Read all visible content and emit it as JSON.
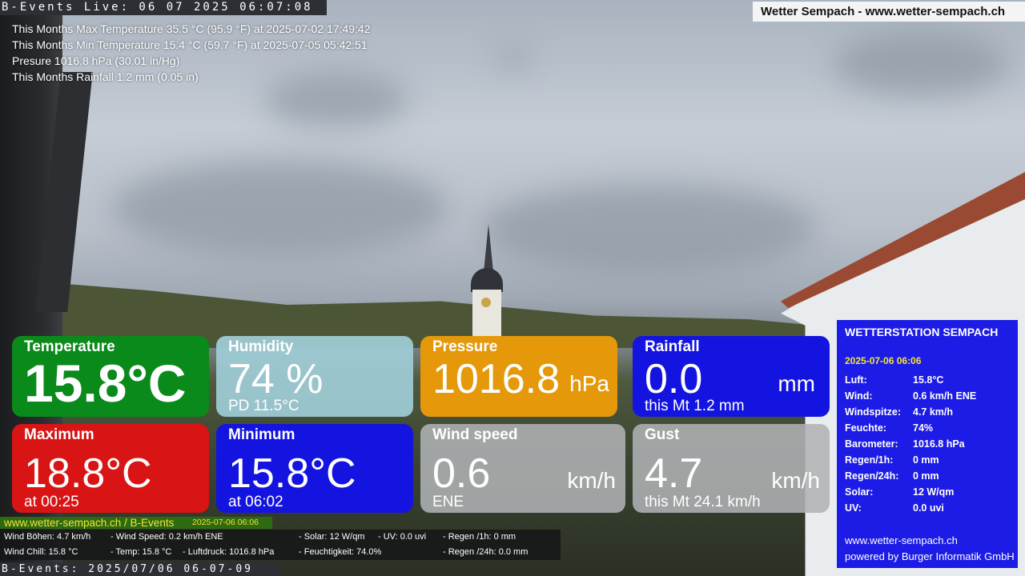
{
  "header": {
    "live_label": "B-Events Live: 06 07 2025 06:07:08",
    "site_title": "Wetter Sempach - www.wetter-sempach.ch"
  },
  "stats": [
    "This Months Max Temperature 35.5 °C (95.9 °F) at 2025-07-02 17:49:42",
    "This Months Min Temperature 15.4 °C (59.7 °F) at 2025-07-05 05:42:51",
    "Presure 1016.8 hPa (30.01 in/Hg)",
    "This Months Rainfall 1.2 mm (0.05 in)"
  ],
  "tiles": {
    "temperature": {
      "title": "Temperature",
      "value": "15.8°C",
      "color": "#0a8a1a"
    },
    "humidity": {
      "title": "Humidity",
      "value": "74 %",
      "sub": "PD 11.5°C"
    },
    "pressure": {
      "title": "Pressure",
      "value": "1016.8",
      "unit": "hPa",
      "color": "#e5990a"
    },
    "rainfall": {
      "title": "Rainfall",
      "value": "0.0",
      "unit": "mm",
      "sub": "this Mt 1.2 mm",
      "color": "#1414e0"
    },
    "maximum": {
      "title": "Maximum",
      "value": "18.8°C",
      "sub": "at 00:25",
      "color": "#d81414"
    },
    "minimum": {
      "title": "Minimum",
      "value": "15.8°C",
      "sub": "at 06:02",
      "color": "#1414e0"
    },
    "wind_speed": {
      "title": "Wind speed",
      "value": "0.6",
      "unit": "km/h",
      "sub": "ENE"
    },
    "gust": {
      "title": "Gust",
      "value": "4.7",
      "unit": "km/h",
      "sub": "this Mt 24.1 km/h"
    }
  },
  "station": {
    "title": "WETTERSTATION SEMPACH",
    "date": "2025-07-06 06:06",
    "rows": [
      {
        "key": "Luft:",
        "value": "15.8°C"
      },
      {
        "key": "Wind:",
        "value": "0.6 km/h  ENE"
      },
      {
        "key": "Windspitze:",
        "value": "4.7 km/h"
      },
      {
        "key": "Feuchte:",
        "value": "74%"
      },
      {
        "key": "Barometer:",
        "value": "1016.8 hPa"
      },
      {
        "key": "Regen/1h:",
        "value": "0 mm"
      },
      {
        "key": "Regen/24h:",
        "value": "0 mm"
      },
      {
        "key": "Solar:",
        "value": "12 W/qm"
      },
      {
        "key": "UV:",
        "value": "0.0 uvi"
      }
    ],
    "footer_site": "www.wetter-sempach.ch",
    "footer_credit": "powered by Burger Informatik GmbH"
  },
  "ticker": {
    "site": "www.wetter-sempach.ch / B-Events",
    "date": "2025-07-06 06:06",
    "line1": {
      "a": "Wind Böhen: 4.7 km/h",
      "b": "- Wind Speed: 0.2 km/h ENE",
      "c": "- Solar: 12 W/qm",
      "d": "- UV: 0.0 uvi",
      "e": "- Regen /1h:   0 mm"
    },
    "line2": {
      "a": "Wind Chill: 15.8 °C",
      "b": "- Temp: 15.8 °C",
      "b2": "- Luftdruck: 1016.8 hPa",
      "c": "- Feuchtigkeit: 74.0%",
      "e": "- Regen /24h: 0.0 mm"
    },
    "bottom_label": "B-Events: 2025/07/06 06-07-09"
  }
}
